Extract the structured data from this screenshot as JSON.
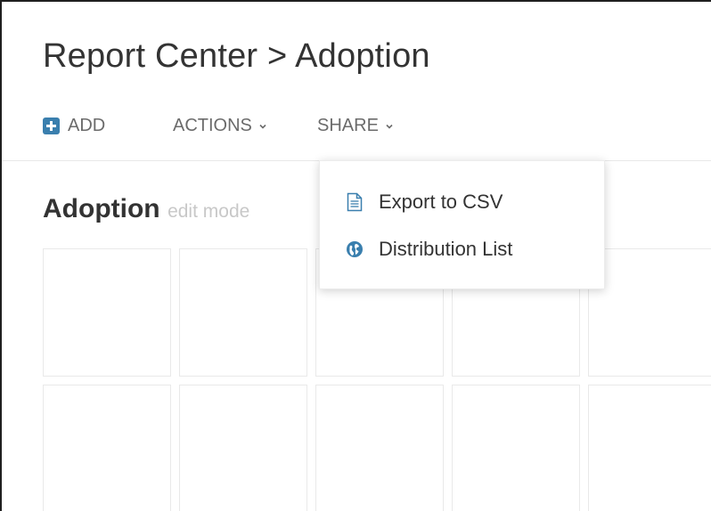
{
  "header": {
    "breadcrumb_root": "Report Center",
    "breadcrumb_sep": ">",
    "breadcrumb_current": "Adoption"
  },
  "toolbar": {
    "add_label": "ADD",
    "actions_label": "ACTIONS",
    "share_label": "SHARE"
  },
  "share_menu": {
    "items": [
      {
        "label": "Export to CSV",
        "icon": "document-icon"
      },
      {
        "label": "Distribution List",
        "icon": "globe-icon"
      }
    ]
  },
  "dashboard": {
    "title": "Adoption",
    "mode": "edit mode"
  },
  "colors": {
    "accent": "#3a7fae",
    "text": "#333333",
    "muted": "#6b6b6b",
    "faint": "#c8c8c8"
  }
}
